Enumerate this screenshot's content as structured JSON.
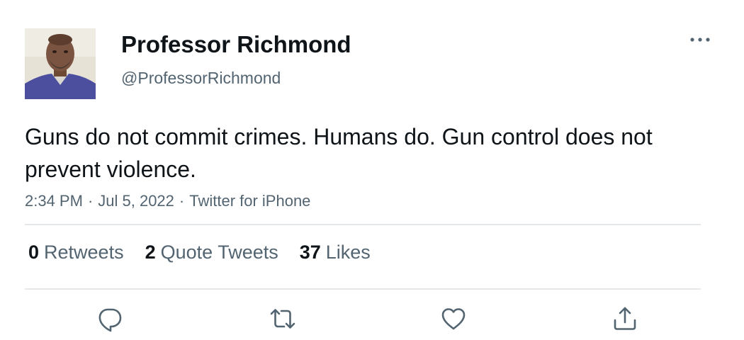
{
  "author": {
    "display_name": "Professor Richmond",
    "handle": "@ProfessorRichmond",
    "avatar_icon": "profile-photo"
  },
  "tweet": {
    "text": "Guns do not commit crimes. Humans do. Gun control does not prevent violence.",
    "time": "2:34 PM",
    "date": "Jul 5, 2022",
    "source": "Twitter for iPhone",
    "separator": "·"
  },
  "stats": {
    "retweets": {
      "count": "0",
      "label": "Retweets"
    },
    "quote_tweets": {
      "count": "2",
      "label": "Quote Tweets"
    },
    "likes": {
      "count": "37",
      "label": "Likes"
    }
  },
  "actions": {
    "reply_icon": "reply-icon",
    "retweet_icon": "retweet-icon",
    "like_icon": "heart-icon",
    "share_icon": "share-icon",
    "more_icon": "more-options-icon"
  },
  "colors": {
    "text_primary": "#0f1419",
    "text_secondary": "#536471",
    "divider": "#e4e8eb",
    "icon": "#536471"
  }
}
